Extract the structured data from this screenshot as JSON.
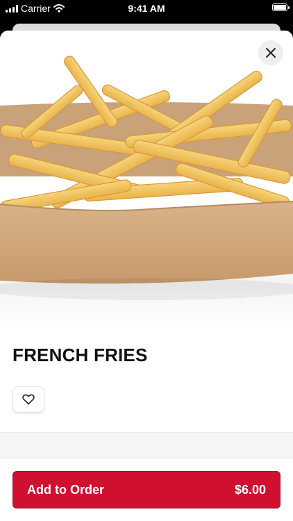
{
  "status_bar": {
    "carrier": "Carrier",
    "time": "9:41 AM"
  },
  "product": {
    "title": "FRENCH FRIES",
    "image_icon": "french-fries-photo"
  },
  "actions": {
    "close_icon": "close-icon",
    "favorite_icon": "heart-icon",
    "add_label": "Add to Order",
    "price": "$6.00"
  },
  "colors": {
    "accent": "#d0102f"
  }
}
